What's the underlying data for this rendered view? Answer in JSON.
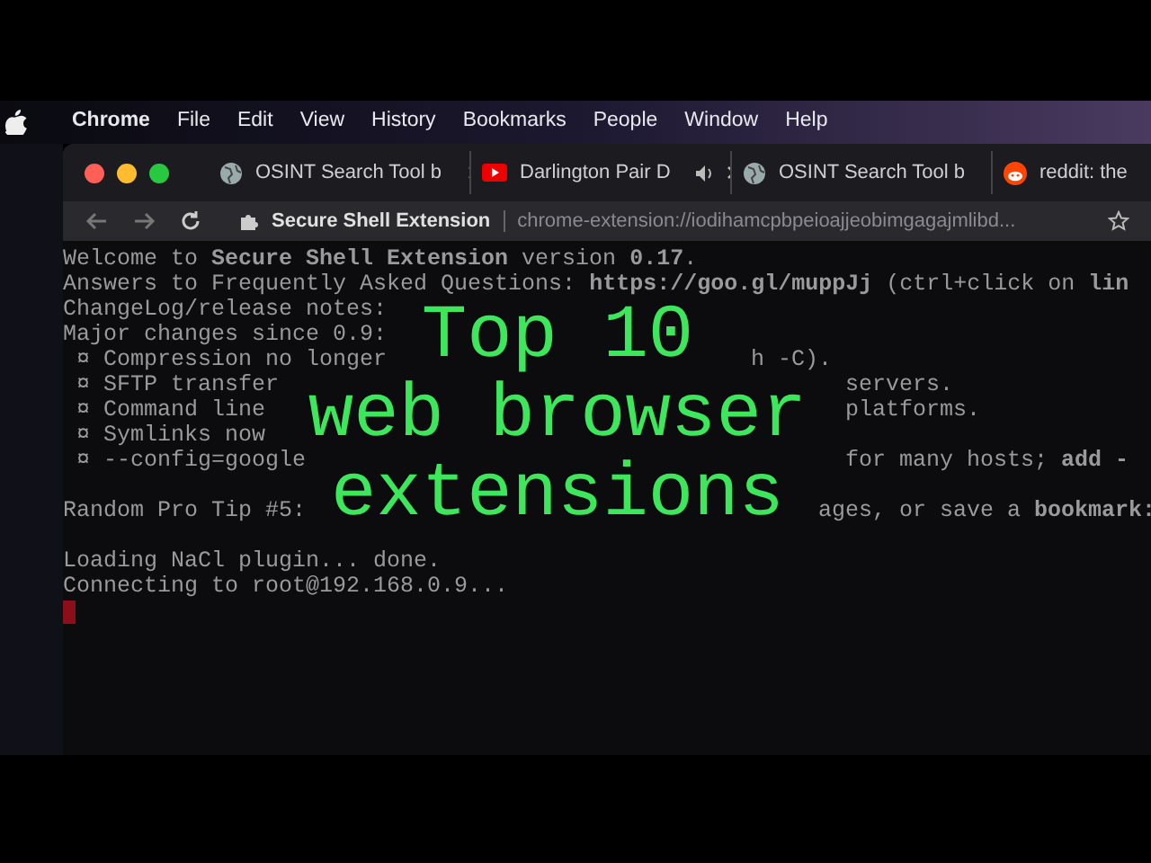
{
  "menu_bar": {
    "app": "Chrome",
    "items": [
      "File",
      "Edit",
      "View",
      "History",
      "Bookmarks",
      "People",
      "Window",
      "Help"
    ]
  },
  "tabs": [
    {
      "kind": "globe",
      "title": "OSINT Search Tool b",
      "audio": false,
      "selected": false
    },
    {
      "kind": "play",
      "title": "Darlington Pair D",
      "audio": true,
      "selected": false
    },
    {
      "kind": "globe",
      "title": "OSINT Search Tool b",
      "audio": false,
      "selected": false
    },
    {
      "kind": "alien",
      "title": "reddit: the",
      "audio": false,
      "selected": false
    }
  ],
  "address_bar": {
    "site": "Secure Shell Extension",
    "url": "chrome-extension://iodihamcpbpeioajjeobimgagajmlibd..."
  },
  "terminal": {
    "blocks": [
      [
        [
          "Welcome to **Secure Shell Extension** version **0.17**."
        ],
        [
          "Answers to Frequently Asked Questions: **https://goo.gl/muppJj** (ctrl+click on **lin**"
        ],
        [
          "ChangeLog/release notes:"
        ],
        [
          "Major changes since 0.9:"
        ],
        [
          " ¤ Compression no longer",
          "h -C)."
        ],
        [
          " ¤ SFTP transfer",
          "servers."
        ],
        [
          " ¤ Command line",
          "platforms."
        ],
        [
          " ¤ Symlinks now"
        ],
        [
          " ¤ --config=google",
          "for many hosts; **add -**"
        ]
      ],
      [
        [
          "Random Pro Tip #5:",
          "ages, or save a **bookmark:**"
        ]
      ],
      [
        [
          "Loading NaCl plugin... done."
        ],
        [
          "Connecting to root@192.168.0.9..."
        ]
      ]
    ],
    "cursor": true
  },
  "overlay_title": [
    "Top 10",
    "web browser",
    "extensions"
  ]
}
